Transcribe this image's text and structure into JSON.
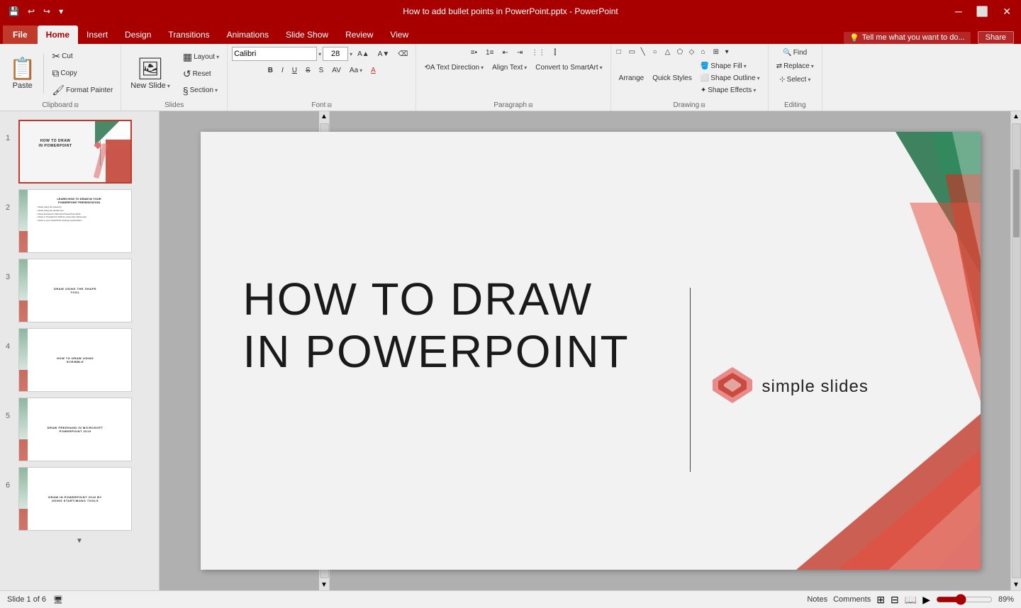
{
  "titlebar": {
    "title": "How to add bullet points in PowerPoint.pptx - PowerPoint",
    "qat": [
      "save",
      "undo",
      "redo",
      "customize"
    ],
    "window_btns": [
      "minimize",
      "restore",
      "maximize",
      "close"
    ]
  },
  "ribbon": {
    "tabs": [
      "File",
      "Home",
      "Insert",
      "Design",
      "Transitions",
      "Animations",
      "Slide Show",
      "Review",
      "View"
    ],
    "active_tab": "Home",
    "tell_me": "Tell me what you want to do...",
    "share": "Share",
    "groups": {
      "clipboard": {
        "label": "Clipboard",
        "paste": "Paste",
        "cut": "Cut",
        "copy": "Copy",
        "format_painter": "Format Painter"
      },
      "slides": {
        "label": "Slides",
        "new_slide": "New Slide",
        "layout": "Layout",
        "reset": "Reset",
        "section": "Section"
      },
      "font": {
        "label": "Font",
        "font_name": "Calibri",
        "font_size": "28",
        "bold": "B",
        "italic": "I",
        "underline": "U",
        "strikethrough": "S",
        "shadow": "S",
        "font_color": "A"
      },
      "paragraph": {
        "label": "Paragraph",
        "text_direction": "Text Direction",
        "align_text": "Align Text",
        "convert_smartart": "Convert to SmartArt"
      },
      "drawing": {
        "label": "Drawing",
        "arrange": "Arrange",
        "quick_styles": "Quick Styles",
        "shape_fill": "Shape Fill",
        "shape_outline": "Shape Outline",
        "shape_effects": "Shape Effects"
      },
      "editing": {
        "label": "Editing",
        "find": "Find",
        "replace": "Replace",
        "select": "Select"
      }
    }
  },
  "slides": [
    {
      "num": 1,
      "active": true,
      "title": "HOW TO DRAW\nIN POWERPOINT"
    },
    {
      "num": 2,
      "title": "LEARN HOW TO DRAW IN YOUR POWERPOINT PRESENTATION"
    },
    {
      "num": 3,
      "title": "DRAW USING THE SHAPE TOOL"
    },
    {
      "num": 4,
      "title": "HOW TO DRAW USING SCRIBBLE"
    },
    {
      "num": 5,
      "title": "DRAW FREEHAND IN MICROSOFT POWERPOINT 2019"
    },
    {
      "num": 6,
      "title": "DRAW IN POWERPOINT 2016 BY USING START/MONO TOOLS"
    }
  ],
  "canvas": {
    "slide_title_line1": "HOW TO DRAW",
    "slide_title_line2": "IN POWERPOINT",
    "logo_text": "simple slides"
  },
  "statusbar": {
    "slide_info": "Slide 1 of 6",
    "notes": "Notes",
    "comments": "Comments",
    "zoom": "89%"
  }
}
